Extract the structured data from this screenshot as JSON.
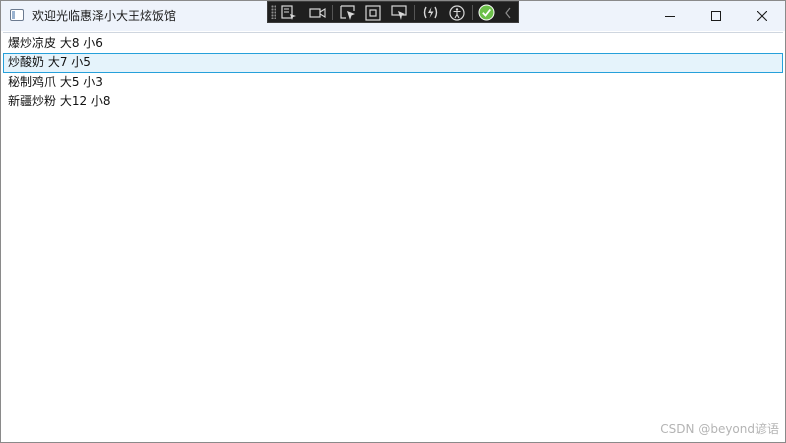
{
  "window": {
    "title": "欢迎光临惠泽小大王炫饭馆",
    "app_icon": "window-app-icon",
    "caption_buttons": [
      "minimize-icon",
      "maximize-icon",
      "close-icon"
    ]
  },
  "debug_toolbar": {
    "icons": [
      "go-to-live-visual-tree-icon",
      "video-record-icon",
      "select-element-icon",
      "display-layout-adorners-icon",
      "track-focused-element-icon",
      "hot-reload-icon",
      "accessibility-checker-icon",
      "status-ok-check-icon",
      "collapse-toolbar-chevron-icon"
    ]
  },
  "list": {
    "items": [
      {
        "label": "爆炒凉皮 大8 小6",
        "selected": false
      },
      {
        "label": "炒酸奶 大7 小5",
        "selected": true
      },
      {
        "label": "秘制鸡爪 大5 小3",
        "selected": false
      },
      {
        "label": "新疆炒粉 大12 小8",
        "selected": false
      }
    ]
  },
  "watermark": "CSDN @beyond谚语",
  "colors": {
    "titlebar_bg": "#eef3fb",
    "selection_bg": "#e5f3fb",
    "selection_border": "#26a0da",
    "toolbar_bg": "#1f1f1f",
    "status_ok": "#6cc04a"
  }
}
